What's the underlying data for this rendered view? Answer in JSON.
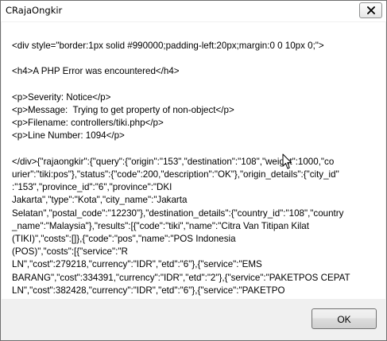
{
  "window": {
    "title": "CRajaOngkir",
    "close_icon": "close-icon"
  },
  "message": {
    "lines_group_1": [
      "<div style=\"border:1px solid #990000;padding-left:20px;margin:0 0 10px 0;\">"
    ],
    "lines_group_2": [
      "<h4>A PHP Error was encountered</h4>"
    ],
    "lines_group_3": [
      "<p>Severity: Notice</p>",
      "<p>Message:  Trying to get property of non-object</p>",
      "<p>Filename: controllers/tiki.php</p>",
      "<p>Line Number: 1094</p>"
    ],
    "lines_group_4": [
      "</div>{\"rajaongkir\":{\"query\":{\"origin\":\"153\",\"destination\":\"108\",\"weight\":1000,\"co",
      "urier\":\"tiki:pos\"},\"status\":{\"code\":200,\"description\":\"OK\"},\"origin_details\":{\"city_id\"",
      ":\"153\",\"province_id\":\"6\",\"province\":\"DKI",
      "Jakarta\",\"type\":\"Kota\",\"city_name\":\"Jakarta",
      "Selatan\",\"postal_code\":\"12230\"},\"destination_details\":{\"country_id\":\"108\",\"country",
      "_name\":\"Malaysia\"},\"results\":[{\"code\":\"tiki\",\"name\":\"Citra Van Titipan Kilat",
      "(TIKI)\",\"costs\":[]},{\"code\":\"pos\",\"name\":\"POS Indonesia",
      "(POS)\",\"costs\":[{\"service\":\"R",
      "LN\",\"cost\":279218,\"currency\":\"IDR\",\"etd\":\"6\"},{\"service\":\"EMS",
      "BARANG\",\"cost\":334391,\"currency\":\"IDR\",\"etd\":\"2\"},{\"service\":\"PAKETPOS CEPAT",
      "LN\",\"cost\":382428,\"currency\":\"IDR\",\"etd\":\"6\"},{\"service\":\"PAKETPO"
    ]
  },
  "buttons": {
    "ok_label": "OK"
  },
  "icons": {
    "cursor": "mouse-pointer-icon"
  }
}
